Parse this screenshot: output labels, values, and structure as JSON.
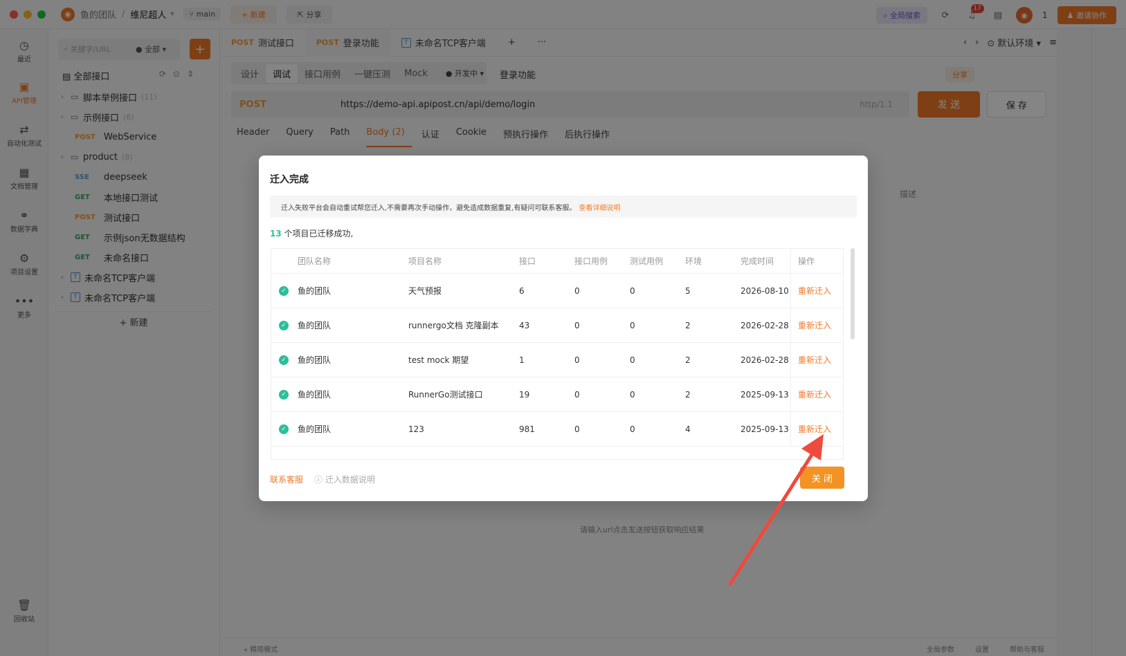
{
  "titlebar": {
    "team": "鱼的团队",
    "separator": "/",
    "project": "维尼超人",
    "branch": "main",
    "new_label": "+ 新建",
    "share_label": "分享",
    "global_search": "全局搜索",
    "notif_count": "17",
    "user_count": "1",
    "invite_label": "邀请协作",
    "colors": {
      "accent": "#f17a2a",
      "red_light": "#ff5f57",
      "yellow_light": "#febc2e",
      "green_light": "#28c840"
    }
  },
  "rail": [
    {
      "label": "最近",
      "icon": "clock-icon"
    },
    {
      "label": "API管理",
      "icon": "api-icon"
    },
    {
      "label": "自动化测试",
      "icon": "flow-icon"
    },
    {
      "label": "文档管理",
      "icon": "doc-icon"
    },
    {
      "label": "数据字典",
      "icon": "dict-icon"
    },
    {
      "label": "项目设置",
      "icon": "settings-icon"
    },
    {
      "label": "更多",
      "icon": "more-icon"
    },
    {
      "label": "回收站",
      "icon": "trash-icon"
    }
  ],
  "sidebar": {
    "search_placeholder": "关键字/URL",
    "filter": "全部",
    "all_label": "全部接口",
    "tree": [
      {
        "type": "folder",
        "label": "脚本举例接口",
        "count": "(11)"
      },
      {
        "type": "folder",
        "label": "示例接口",
        "count": "(6)"
      },
      {
        "type": "api",
        "method": "POST",
        "label": "WebService"
      },
      {
        "type": "folder",
        "label": "product",
        "count": "(8)"
      },
      {
        "type": "api",
        "method": "SSE",
        "label": "deepseek"
      },
      {
        "type": "api",
        "method": "GET",
        "label": "本地接口测试"
      },
      {
        "type": "api",
        "method": "POST",
        "label": "测试接口"
      },
      {
        "type": "api",
        "method": "GET",
        "label": "示例json无数据结构"
      },
      {
        "type": "api",
        "method": "GET",
        "label": "未命名接口"
      },
      {
        "type": "tcp",
        "label": "未命名TCP客户端"
      },
      {
        "type": "tcp",
        "label": "未命名TCP客户端"
      }
    ],
    "new_label": "+ 新建"
  },
  "main": {
    "tabs": [
      {
        "method": "POST",
        "label": "测试接口"
      },
      {
        "method": "POST",
        "label": "登录功能"
      },
      {
        "method": "T",
        "label": "未命名TCP客户端"
      }
    ],
    "env_label": "默认环境",
    "subtabs": [
      "设计",
      "调试",
      "接口用例",
      "一键压测",
      "Mock"
    ],
    "status": "开发中",
    "api_title": "登录功能",
    "share": "分享",
    "method": "POST",
    "url": "https://demo-api.apipost.cn/api/demo/login",
    "protocol": "http/1.1",
    "send": "发 送",
    "save": "保 存",
    "req_tabs": [
      "Header",
      "Query",
      "Path",
      "Body (2)",
      "认证",
      "Cookie",
      "预执行操作",
      "后执行操作"
    ],
    "desc_col": "描述",
    "empty_text": "请输入url点击发送按钮获取响应结果",
    "footer_left": "精简模式",
    "footer_right": [
      "全局参数",
      "设置",
      "帮助与客服"
    ]
  },
  "dialog": {
    "title": "迁入完成",
    "notice": "迁入失败平台会自动重试帮您迁入,不需要再次手动操作，避免造成数据重复,有疑问可联系客服。",
    "notice_link": "查看详细说明",
    "summary_count": "13",
    "summary_text": "个项目已迁移成功,",
    "headers": [
      "团队名称",
      "项目名称",
      "接口",
      "接口用例",
      "测试用例",
      "环境",
      "完成时间",
      "操作"
    ],
    "rows": [
      {
        "team": "鱼的团队",
        "project": "天气预报",
        "apis": "6",
        "api_cases": "0",
        "test_cases": "0",
        "envs": "5",
        "time": "2026-08-10",
        "action": "重新迁入"
      },
      {
        "team": "鱼的团队",
        "project": "runnergo文档 克隆副本",
        "apis": "43",
        "api_cases": "0",
        "test_cases": "0",
        "envs": "2",
        "time": "2026-02-28",
        "action": "重新迁入"
      },
      {
        "team": "鱼的团队",
        "project": "test mock 期望",
        "apis": "1",
        "api_cases": "0",
        "test_cases": "0",
        "envs": "2",
        "time": "2026-02-28",
        "action": "重新迁入"
      },
      {
        "team": "鱼的团队",
        "project": "RunnerGo测试接口",
        "apis": "19",
        "api_cases": "0",
        "test_cases": "0",
        "envs": "2",
        "time": "2025-09-13",
        "action": "重新迁入"
      },
      {
        "team": "鱼的团队",
        "project": "123",
        "apis": "981",
        "api_cases": "0",
        "test_cases": "0",
        "envs": "4",
        "time": "2025-09-13",
        "action": "重新迁入"
      }
    ],
    "support": "联系客服",
    "help": "迁入数据说明",
    "close": "关 闭"
  }
}
